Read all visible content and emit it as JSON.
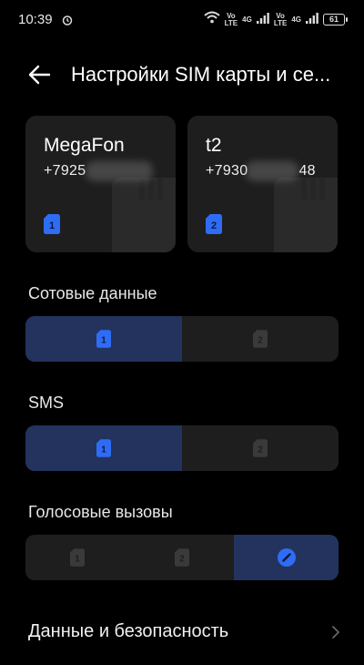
{
  "status_bar": {
    "time": "10:39",
    "sim1_volte": [
      "Vo",
      "LTE"
    ],
    "sim1_network": "4G",
    "sim2_volte": [
      "Vo",
      "LTE"
    ],
    "sim2_network": "4G",
    "battery": "61"
  },
  "header": {
    "title": "Настройки SIM карты и се..."
  },
  "sim_cards": [
    {
      "carrier": "MegaFon",
      "number": "+7925",
      "slot": "1"
    },
    {
      "carrier": "t2",
      "number_start": "+7930",
      "number_end": "48",
      "slot": "2"
    }
  ],
  "mobile_data": {
    "label": "Сотовые данные",
    "options": [
      "1",
      "2"
    ],
    "selected": "1"
  },
  "sms": {
    "label": "SMS",
    "options": [
      "1",
      "2"
    ],
    "selected": "1"
  },
  "voice_calls": {
    "label": "Голосовые вызовы",
    "options": [
      "1",
      "2",
      "ask"
    ],
    "selected": "ask"
  },
  "data_security": {
    "label": "Данные и безопасность"
  },
  "colors": {
    "background": "#000000",
    "card": "#1e1e1e",
    "selected": "#23335e",
    "accent": "#2f6cf6",
    "inactive": "#3a3a3a"
  }
}
